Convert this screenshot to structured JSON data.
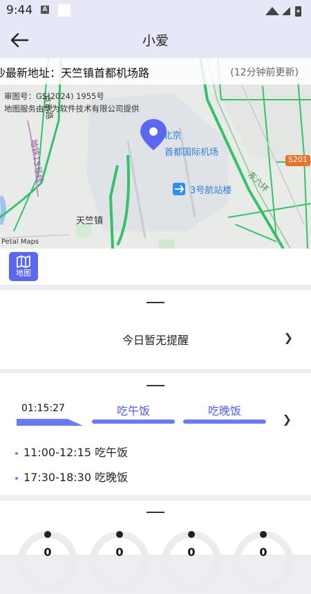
{
  "status_bar": {
    "time": "9:44",
    "notification_letter": "A"
  },
  "app_bar": {
    "title": "小爱"
  },
  "map": {
    "address_label": "沙最新地址：天竺镇首都机场路",
    "update_time": "(12分钟前更新)",
    "approval_no": "审图号：GS(2024) 1955号",
    "service_note": "地图服务由华为软件技术有限公司提供",
    "city_label": "北京",
    "airport_label": "首都国际机场",
    "terminal_label": "3号航站楼",
    "town_label": "天竺镇",
    "highway_badge": "S201",
    "road_east_ring": "东六环",
    "road_metro_line": "地铁15号线",
    "road_vertical": "京承路",
    "brand": "Petal Maps",
    "map_button_label": "地图",
    "colors": {
      "pin": "#5b67f0",
      "road_green": "#35c16a",
      "map_bg": "#e9ebe9"
    }
  },
  "reminder_card": {
    "text": "今日暂无提醒"
  },
  "schedule_card": {
    "elapsed_time": "01:15:27",
    "segments": [
      "吃午饭",
      "吃晚饭"
    ],
    "items": [
      {
        "time": "11:00-12:15",
        "label": "吃午饭"
      },
      {
        "time": "17:30-18:30",
        "label": "吃晚饭"
      }
    ],
    "accent": "#6c7af2"
  },
  "stats_card": {
    "gauges": [
      {
        "value": "0"
      },
      {
        "value": "0"
      },
      {
        "value": "0"
      },
      {
        "value": "0"
      }
    ]
  }
}
